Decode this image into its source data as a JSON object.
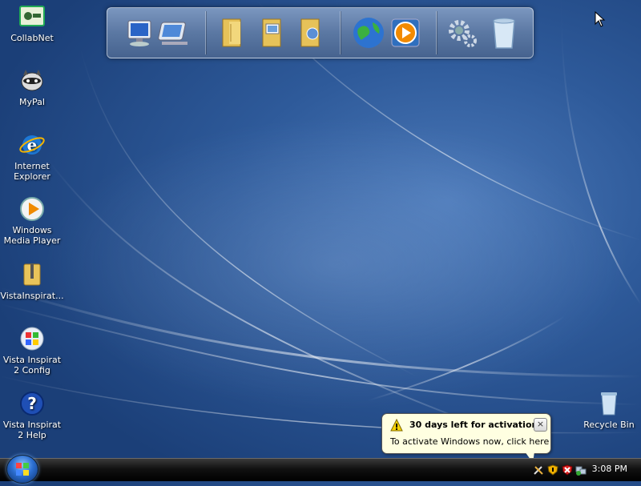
{
  "desktop": {
    "icons": [
      {
        "label": "CollabNet"
      },
      {
        "label": "MyPal"
      },
      {
        "label": "Internet Explorer"
      },
      {
        "label": "Windows Media Player"
      },
      {
        "label": "VistaInspirat..."
      },
      {
        "label": "Vista Inspirat 2 Config"
      },
      {
        "label": "Vista Inspirat 2 Help"
      },
      {
        "label": "Recycle Bin"
      }
    ]
  },
  "dock": {
    "items": [
      "computer-icon",
      "network-icon",
      "folder-icon",
      "pictures-folder-icon",
      "music-folder-icon",
      "globe-icon",
      "media-player-icon",
      "settings-gears-icon",
      "recycle-bin-icon"
    ]
  },
  "balloon": {
    "title": "30 days left for activation",
    "text": "To activate Windows now, click here",
    "close_label": "×"
  },
  "taskbar": {
    "clock": "3:08 PM"
  },
  "colors": {
    "desktop_blue": "#2e5a9a",
    "taskbar_black": "#111111",
    "balloon_bg": "#ffffe1"
  }
}
